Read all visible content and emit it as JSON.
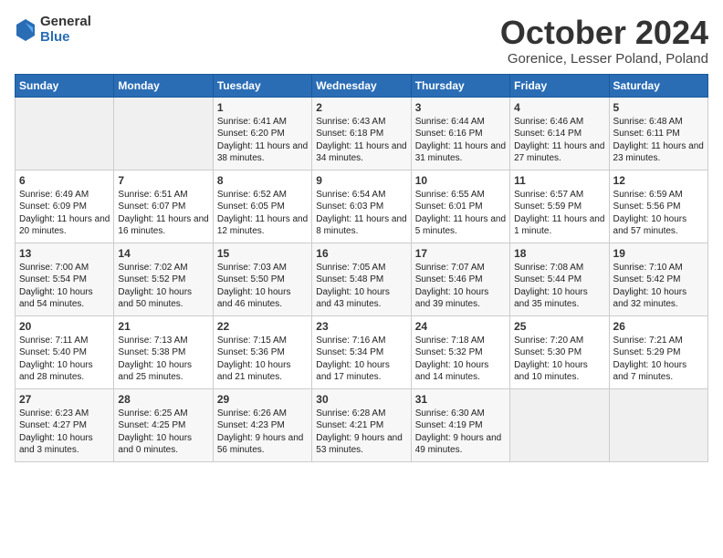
{
  "header": {
    "logo_general": "General",
    "logo_blue": "Blue",
    "month_title": "October 2024",
    "location": "Gorenice, Lesser Poland, Poland"
  },
  "days_of_week": [
    "Sunday",
    "Monday",
    "Tuesday",
    "Wednesday",
    "Thursday",
    "Friday",
    "Saturday"
  ],
  "weeks": [
    [
      {
        "day": "",
        "info": ""
      },
      {
        "day": "",
        "info": ""
      },
      {
        "day": "1",
        "info": "Sunrise: 6:41 AM\nSunset: 6:20 PM\nDaylight: 11 hours and 38 minutes."
      },
      {
        "day": "2",
        "info": "Sunrise: 6:43 AM\nSunset: 6:18 PM\nDaylight: 11 hours and 34 minutes."
      },
      {
        "day": "3",
        "info": "Sunrise: 6:44 AM\nSunset: 6:16 PM\nDaylight: 11 hours and 31 minutes."
      },
      {
        "day": "4",
        "info": "Sunrise: 6:46 AM\nSunset: 6:14 PM\nDaylight: 11 hours and 27 minutes."
      },
      {
        "day": "5",
        "info": "Sunrise: 6:48 AM\nSunset: 6:11 PM\nDaylight: 11 hours and 23 minutes."
      }
    ],
    [
      {
        "day": "6",
        "info": "Sunrise: 6:49 AM\nSunset: 6:09 PM\nDaylight: 11 hours and 20 minutes."
      },
      {
        "day": "7",
        "info": "Sunrise: 6:51 AM\nSunset: 6:07 PM\nDaylight: 11 hours and 16 minutes."
      },
      {
        "day": "8",
        "info": "Sunrise: 6:52 AM\nSunset: 6:05 PM\nDaylight: 11 hours and 12 minutes."
      },
      {
        "day": "9",
        "info": "Sunrise: 6:54 AM\nSunset: 6:03 PM\nDaylight: 11 hours and 8 minutes."
      },
      {
        "day": "10",
        "info": "Sunrise: 6:55 AM\nSunset: 6:01 PM\nDaylight: 11 hours and 5 minutes."
      },
      {
        "day": "11",
        "info": "Sunrise: 6:57 AM\nSunset: 5:59 PM\nDaylight: 11 hours and 1 minute."
      },
      {
        "day": "12",
        "info": "Sunrise: 6:59 AM\nSunset: 5:56 PM\nDaylight: 10 hours and 57 minutes."
      }
    ],
    [
      {
        "day": "13",
        "info": "Sunrise: 7:00 AM\nSunset: 5:54 PM\nDaylight: 10 hours and 54 minutes."
      },
      {
        "day": "14",
        "info": "Sunrise: 7:02 AM\nSunset: 5:52 PM\nDaylight: 10 hours and 50 minutes."
      },
      {
        "day": "15",
        "info": "Sunrise: 7:03 AM\nSunset: 5:50 PM\nDaylight: 10 hours and 46 minutes."
      },
      {
        "day": "16",
        "info": "Sunrise: 7:05 AM\nSunset: 5:48 PM\nDaylight: 10 hours and 43 minutes."
      },
      {
        "day": "17",
        "info": "Sunrise: 7:07 AM\nSunset: 5:46 PM\nDaylight: 10 hours and 39 minutes."
      },
      {
        "day": "18",
        "info": "Sunrise: 7:08 AM\nSunset: 5:44 PM\nDaylight: 10 hours and 35 minutes."
      },
      {
        "day": "19",
        "info": "Sunrise: 7:10 AM\nSunset: 5:42 PM\nDaylight: 10 hours and 32 minutes."
      }
    ],
    [
      {
        "day": "20",
        "info": "Sunrise: 7:11 AM\nSunset: 5:40 PM\nDaylight: 10 hours and 28 minutes."
      },
      {
        "day": "21",
        "info": "Sunrise: 7:13 AM\nSunset: 5:38 PM\nDaylight: 10 hours and 25 minutes."
      },
      {
        "day": "22",
        "info": "Sunrise: 7:15 AM\nSunset: 5:36 PM\nDaylight: 10 hours and 21 minutes."
      },
      {
        "day": "23",
        "info": "Sunrise: 7:16 AM\nSunset: 5:34 PM\nDaylight: 10 hours and 17 minutes."
      },
      {
        "day": "24",
        "info": "Sunrise: 7:18 AM\nSunset: 5:32 PM\nDaylight: 10 hours and 14 minutes."
      },
      {
        "day": "25",
        "info": "Sunrise: 7:20 AM\nSunset: 5:30 PM\nDaylight: 10 hours and 10 minutes."
      },
      {
        "day": "26",
        "info": "Sunrise: 7:21 AM\nSunset: 5:29 PM\nDaylight: 10 hours and 7 minutes."
      }
    ],
    [
      {
        "day": "27",
        "info": "Sunrise: 6:23 AM\nSunset: 4:27 PM\nDaylight: 10 hours and 3 minutes."
      },
      {
        "day": "28",
        "info": "Sunrise: 6:25 AM\nSunset: 4:25 PM\nDaylight: 10 hours and 0 minutes."
      },
      {
        "day": "29",
        "info": "Sunrise: 6:26 AM\nSunset: 4:23 PM\nDaylight: 9 hours and 56 minutes."
      },
      {
        "day": "30",
        "info": "Sunrise: 6:28 AM\nSunset: 4:21 PM\nDaylight: 9 hours and 53 minutes."
      },
      {
        "day": "31",
        "info": "Sunrise: 6:30 AM\nSunset: 4:19 PM\nDaylight: 9 hours and 49 minutes."
      },
      {
        "day": "",
        "info": ""
      },
      {
        "day": "",
        "info": ""
      }
    ]
  ],
  "accent_color": "#2a6db5"
}
